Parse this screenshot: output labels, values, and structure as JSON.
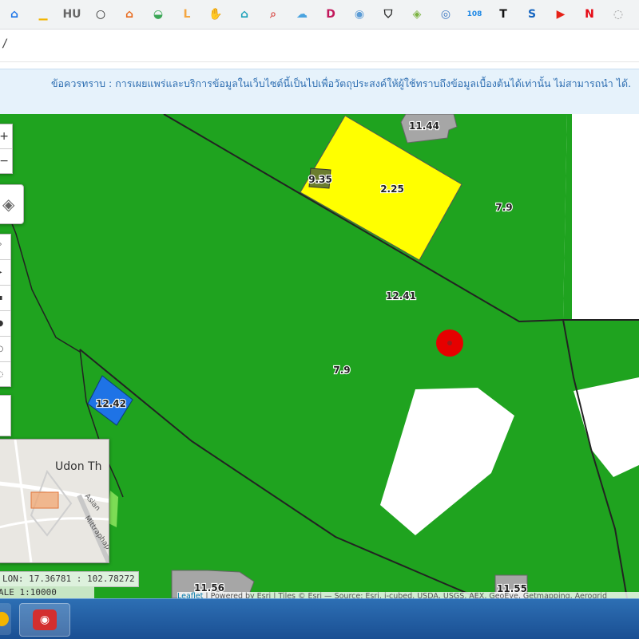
{
  "bookmarks": [
    {
      "icon": "home-icon",
      "glyph": "⌂",
      "color": "#1a73e8"
    },
    {
      "icon": "chart-icon",
      "glyph": "▁",
      "color": "#f2b400"
    },
    {
      "icon": "hu-logo-icon",
      "glyph": "HU",
      "color": "#666666"
    },
    {
      "icon": "chat-icon",
      "glyph": "○",
      "color": "#222222"
    },
    {
      "icon": "house-icon",
      "glyph": "⌂",
      "color": "#e8681a"
    },
    {
      "icon": "car-icon",
      "glyph": "◒",
      "color": "#3aa655"
    },
    {
      "icon": "living-logo-icon",
      "glyph": "L",
      "color": "#f4a640"
    },
    {
      "icon": "hand-icon",
      "glyph": "✋",
      "color": "#e06a1b"
    },
    {
      "icon": "house-outline-icon",
      "glyph": "⌂",
      "color": "#1aa0b8"
    },
    {
      "icon": "magnifier-icon",
      "glyph": "⌕",
      "color": "#d9534f"
    },
    {
      "icon": "cloud-icon",
      "glyph": "☁",
      "color": "#4aa3df"
    },
    {
      "icon": "d-logo-icon",
      "glyph": "D",
      "color": "#c2185b"
    },
    {
      "icon": "globe-home-icon",
      "glyph": "◉",
      "color": "#5b9bd5"
    },
    {
      "icon": "shield-icon",
      "glyph": "⛉",
      "color": "#222222"
    },
    {
      "icon": "map-pin-icon",
      "glyph": "◈",
      "color": "#7cb342"
    },
    {
      "icon": "circle-logo-icon",
      "glyph": "◎",
      "color": "#3b78c2"
    },
    {
      "icon": "calendar-108-icon",
      "glyph": "108",
      "color": "#1e88e5"
    },
    {
      "icon": "t-logo-icon",
      "glyph": "T",
      "color": "#111111"
    },
    {
      "icon": "s-logo-icon",
      "glyph": "S",
      "color": "#1565c0"
    },
    {
      "icon": "youtube-icon",
      "glyph": "▶",
      "color": "#e62117"
    },
    {
      "icon": "netflix-icon",
      "glyph": "N",
      "color": "#e50914"
    },
    {
      "icon": "extra-icon",
      "glyph": "◌",
      "color": "#999999"
    }
  ],
  "address": {
    "text": "/"
  },
  "notice": {
    "text": "ข้อควรทราบ : การเผยแพร่และบริการข้อมูลในเว็บไซต์นี้เป็นไปเพื่อวัตถุประสงค์ให้ผู้ใช้ทราบถึงข้อมูลเบื้องต้นได้เท่านั้น ไม่สามารถนำ ได้."
  },
  "map": {
    "parcel_labels": [
      "11.44",
      "9.35",
      "2.25",
      "7.9",
      "12.41",
      "7.9",
      "12.42",
      "11.56",
      "11.55"
    ],
    "colors": {
      "green": "#1fa31f",
      "yellow": "#ffff00",
      "blue": "#1e73e6",
      "grey": "#a6a6a6",
      "marker": "#e60000"
    },
    "controls": {
      "zoom_in": "+",
      "zoom_out": "−"
    }
  },
  "minimap": {
    "title": "Udon Th",
    "road1": "Asian",
    "road2": "Mittraphap"
  },
  "coordinates": {
    "text": "LON: 17.36781 : 102.78272"
  },
  "scale": {
    "text": "ALE 1:10000"
  },
  "attribution": {
    "leaflet": "Leaflet",
    "text": " | Powered by Esri | Tiles © Esri — Source: Esri, i-cubed, USDA, USGS, AEX, GeoEye, Getmapping, Aerogrid"
  },
  "taskbar": {
    "colors": {
      "camera": "#d32f2f",
      "app": "#f4b400"
    }
  }
}
